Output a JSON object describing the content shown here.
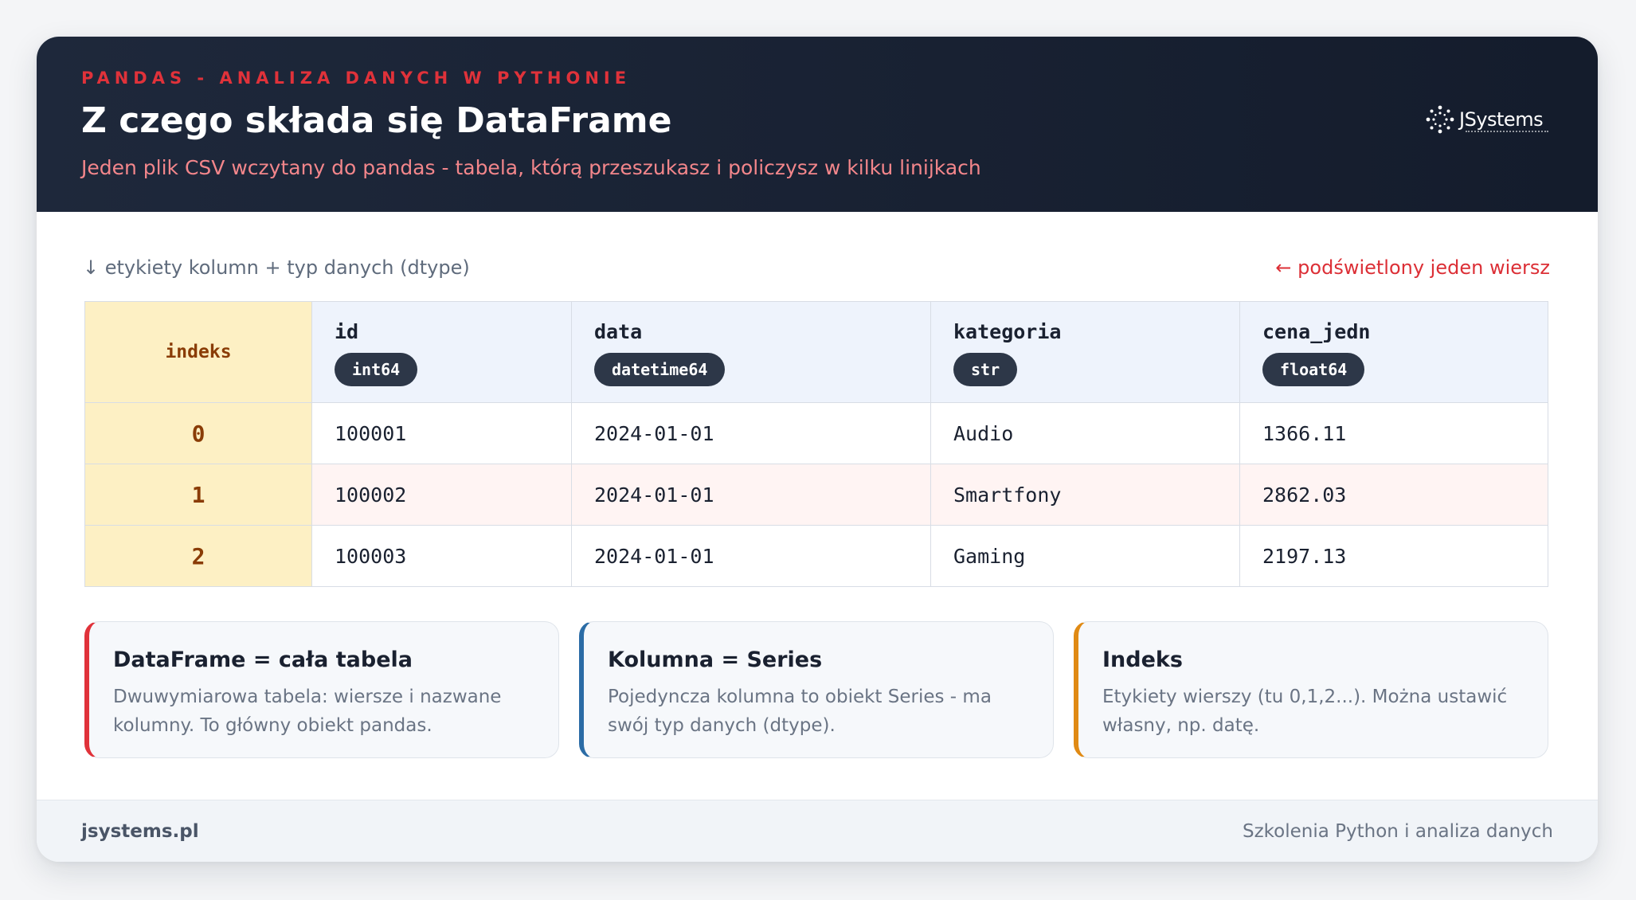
{
  "header": {
    "eyebrow": "PANDAS - ANALIZA DANYCH W PYTHONIE",
    "title": "Z czego składa się DataFrame",
    "subtitle": "Jeden plik CSV wczytany do pandas - tabela, którą przeszukasz i policzysz w kilku linijkach",
    "logo": "JSystems",
    "logo_icon": "sparkle-dots-icon"
  },
  "labels": {
    "columns_hint": "↓ etykiety kolumn + typ danych (dtype)",
    "row_hint": "← podświetlony jeden wiersz"
  },
  "table": {
    "index_header": "indeks",
    "columns": [
      {
        "name": "id",
        "dtype": "int64"
      },
      {
        "name": "data",
        "dtype": "datetime64"
      },
      {
        "name": "kategoria",
        "dtype": "str"
      },
      {
        "name": "cena_jedn",
        "dtype": "float64"
      }
    ],
    "rows": [
      {
        "index": "0",
        "cells": [
          "100001",
          "2024-01-01",
          "Audio",
          "1366.11"
        ],
        "highlighted": false
      },
      {
        "index": "1",
        "cells": [
          "100002",
          "2024-01-01",
          "Smartfony",
          "2862.03"
        ],
        "highlighted": true
      },
      {
        "index": "2",
        "cells": [
          "100003",
          "2024-01-01",
          "Gaming",
          "2197.13"
        ],
        "highlighted": false
      }
    ]
  },
  "notes": [
    {
      "title": "DataFrame = cała tabela",
      "text": "Dwuwymiarowa tabela: wiersze i nazwane kolumny. To główny obiekt pandas.",
      "accent": "#e0323a"
    },
    {
      "title": "Kolumna = Series",
      "text": "Pojedyncza kolumna to obiekt Series - ma swój typ danych (dtype).",
      "accent": "#2b6ca6"
    },
    {
      "title": "Indeks",
      "text": "Etykiety wierszy (tu 0,1,2...). Można ustawić własny, np. datę.",
      "accent": "#e08a14"
    }
  ],
  "footer": {
    "left": "jsystems.pl",
    "right": "Szkolenia Python i analiza danych"
  },
  "colors": {
    "header_bg": "#1a2334",
    "accent_red": "#e0323a",
    "index_bg": "#fdf0c4",
    "highlight_row": "#fff4f3"
  }
}
